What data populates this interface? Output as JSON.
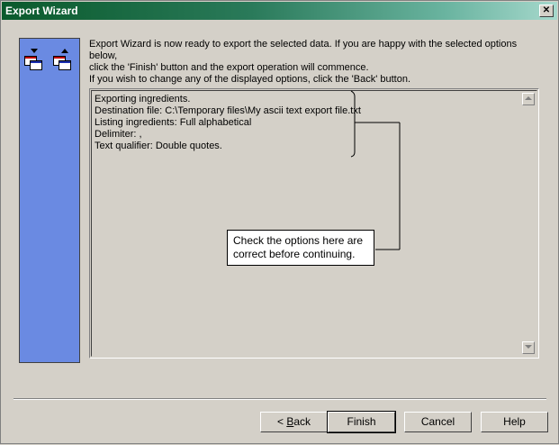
{
  "window": {
    "title": "Export Wizard",
    "close_glyph": "✕"
  },
  "intro": {
    "line1": "Export Wizard is now ready to export the selected data.  If you are happy with the selected options below,",
    "line2": "click the 'Finish' button and the export operation will commence.",
    "instruction": "If you wish to change any of the displayed options, click the 'Back' button."
  },
  "summary": {
    "lines": [
      "Exporting ingredients.",
      "Destination file: C:\\Temporary files\\My ascii text export file.txt",
      "Listing ingredients: Full alphabetical",
      "Delimiter: ,",
      "Text qualifier: Double quotes."
    ]
  },
  "callout": {
    "line1": "Check the options here are",
    "line2": "correct before continuing."
  },
  "buttons": {
    "back_prefix": "< ",
    "back_mnemonic": "B",
    "back_rest": "ack",
    "finish": "Finish",
    "cancel": "Cancel",
    "help": "Help"
  },
  "icons": {
    "wizard": "export-documents-icon",
    "scroll_up": "scroll-up-arrow-icon",
    "scroll_down": "scroll-down-arrow-icon"
  },
  "colors": {
    "side_panel": "#6a8ae2",
    "title_gradient_start": "#0a5a2c",
    "title_gradient_end": "#a6d8cc"
  }
}
